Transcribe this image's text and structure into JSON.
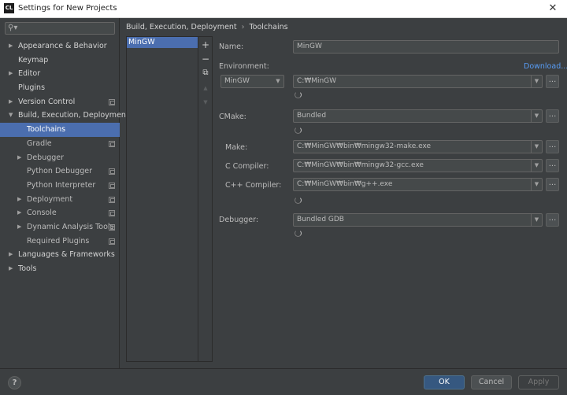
{
  "window": {
    "logo_text": "CL",
    "title": "Settings for New Projects",
    "close_glyph": "✕"
  },
  "search": {
    "placeholder": "",
    "value": ""
  },
  "sidebar": {
    "items": [
      {
        "label": "Appearance & Behavior",
        "level": 0,
        "expandable": true,
        "expanded": false,
        "project_icon": false
      },
      {
        "label": "Keymap",
        "level": 0,
        "expandable": false,
        "project_icon": false
      },
      {
        "label": "Editor",
        "level": 0,
        "expandable": true,
        "expanded": false,
        "project_icon": false
      },
      {
        "label": "Plugins",
        "level": 0,
        "expandable": false,
        "project_icon": false
      },
      {
        "label": "Version Control",
        "level": 0,
        "expandable": true,
        "expanded": false,
        "project_icon": true
      },
      {
        "label": "Build, Execution, Deployment",
        "level": 0,
        "expandable": true,
        "expanded": true,
        "project_icon": false
      },
      {
        "label": "Toolchains",
        "level": 1,
        "expandable": false,
        "project_icon": false,
        "selected": true
      },
      {
        "label": "Gradle",
        "level": 1,
        "expandable": false,
        "project_icon": true
      },
      {
        "label": "Debugger",
        "level": 1,
        "expandable": true,
        "expanded": false,
        "project_icon": false
      },
      {
        "label": "Python Debugger",
        "level": 1,
        "expandable": false,
        "project_icon": true
      },
      {
        "label": "Python Interpreter",
        "level": 1,
        "expandable": false,
        "project_icon": true
      },
      {
        "label": "Deployment",
        "level": 1,
        "expandable": true,
        "expanded": false,
        "project_icon": true
      },
      {
        "label": "Console",
        "level": 1,
        "expandable": true,
        "expanded": false,
        "project_icon": true
      },
      {
        "label": "Dynamic Analysis Tools",
        "level": 1,
        "expandable": true,
        "expanded": false,
        "project_icon": true
      },
      {
        "label": "Required Plugins",
        "level": 1,
        "expandable": false,
        "project_icon": true
      },
      {
        "label": "Languages & Frameworks",
        "level": 0,
        "expandable": true,
        "expanded": false,
        "project_icon": false
      },
      {
        "label": "Tools",
        "level": 0,
        "expandable": true,
        "expanded": false,
        "project_icon": false
      }
    ]
  },
  "breadcrumb": {
    "parent": "Build, Execution, Deployment",
    "separator": "›",
    "current": "Toolchains"
  },
  "toolchains": {
    "items": [
      "MinGW"
    ],
    "toolbar": {
      "add": "+",
      "remove": "−",
      "copy": "⧉",
      "up": "▲",
      "down": "▼"
    }
  },
  "form": {
    "name_label": "Name:",
    "name_value": "MinGW",
    "environment_label": "Environment:",
    "download_link": "Download...",
    "environment_type": "MinGW",
    "environment_path": "C:₩MinGW",
    "cmake_label": "CMake:",
    "cmake_value": "Bundled",
    "make_label": "Make:",
    "make_value": "C:₩MinGW₩bin₩mingw32-make.exe",
    "c_compiler_label": "C Compiler:",
    "c_compiler_value": "C:₩MinGW₩bin₩mingw32-gcc.exe",
    "cpp_compiler_label": "C++ Compiler:",
    "cpp_compiler_value": "C:₩MinGW₩bin₩g++.exe",
    "debugger_label": "Debugger:",
    "debugger_value": "Bundled GDB",
    "browse_glyph": "...",
    "dropdown_glyph": "▼"
  },
  "footer": {
    "help_label": "?",
    "ok_label": "OK",
    "cancel_label": "Cancel",
    "apply_label": "Apply"
  },
  "colors": {
    "background": "#3c3f41",
    "selection": "#4b6eaf",
    "link": "#589df6",
    "ok_button": "#365880"
  }
}
